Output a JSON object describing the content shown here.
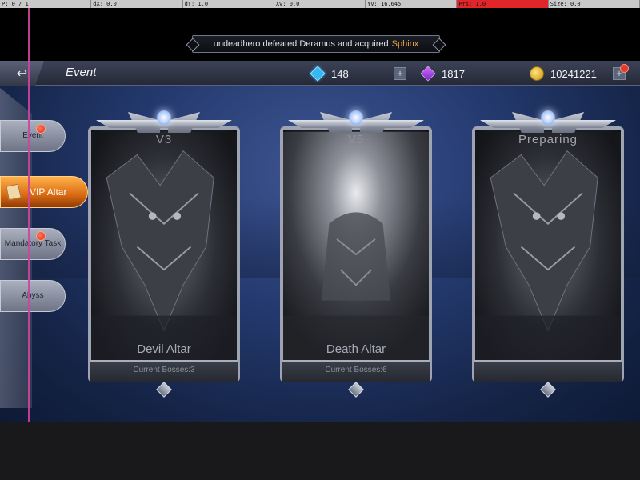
{
  "debug_bar": [
    {
      "text": "P: 0 / 1",
      "highlight": false
    },
    {
      "text": "dX: 0.0",
      "highlight": false
    },
    {
      "text": "dY: 1.0",
      "highlight": false
    },
    {
      "text": "Xv: 0.0",
      "highlight": false
    },
    {
      "text": "Yv: 16.645",
      "highlight": false
    },
    {
      "text": "Prs: 1.0",
      "highlight": true
    },
    {
      "text": "Size: 0.0",
      "highlight": false
    }
  ],
  "broadcast": {
    "message": "undeadhero defeated Deramus and acquired",
    "item": "Sphinx"
  },
  "header": {
    "back_icon": "back-arrow-icon",
    "title": "Event"
  },
  "resources": {
    "gems": "148",
    "crystals": "1817",
    "gold": "10241221",
    "gem_icon": "diamond-icon",
    "crystal_icon": "crystal-icon",
    "gold_icon": "coin-icon",
    "plus_label": "+"
  },
  "sidebar": {
    "items": [
      {
        "label": "Event",
        "has_alert": true,
        "active": false
      },
      {
        "label": "VIP Altar",
        "has_alert": false,
        "active": true
      },
      {
        "label": "Mandatory Task",
        "has_alert": true,
        "active": false
      },
      {
        "label": "Abyss",
        "has_alert": false,
        "active": false
      }
    ]
  },
  "altars": [
    {
      "level": "V3",
      "name": "Devil Altar",
      "bosses": "Current Bosses:3"
    },
    {
      "level": "V5",
      "name": "Death Altar",
      "bosses": "Current Bosses:6"
    },
    {
      "level": "Preparing",
      "name": "",
      "bosses": ""
    }
  ],
  "colors": {
    "accent_active_tab": "#e57a1c",
    "alert_dot": "#d22d1f",
    "broadcast_item": "#e8a33b",
    "header_bg": "#2f3446",
    "background_blue": "#243a6f"
  }
}
